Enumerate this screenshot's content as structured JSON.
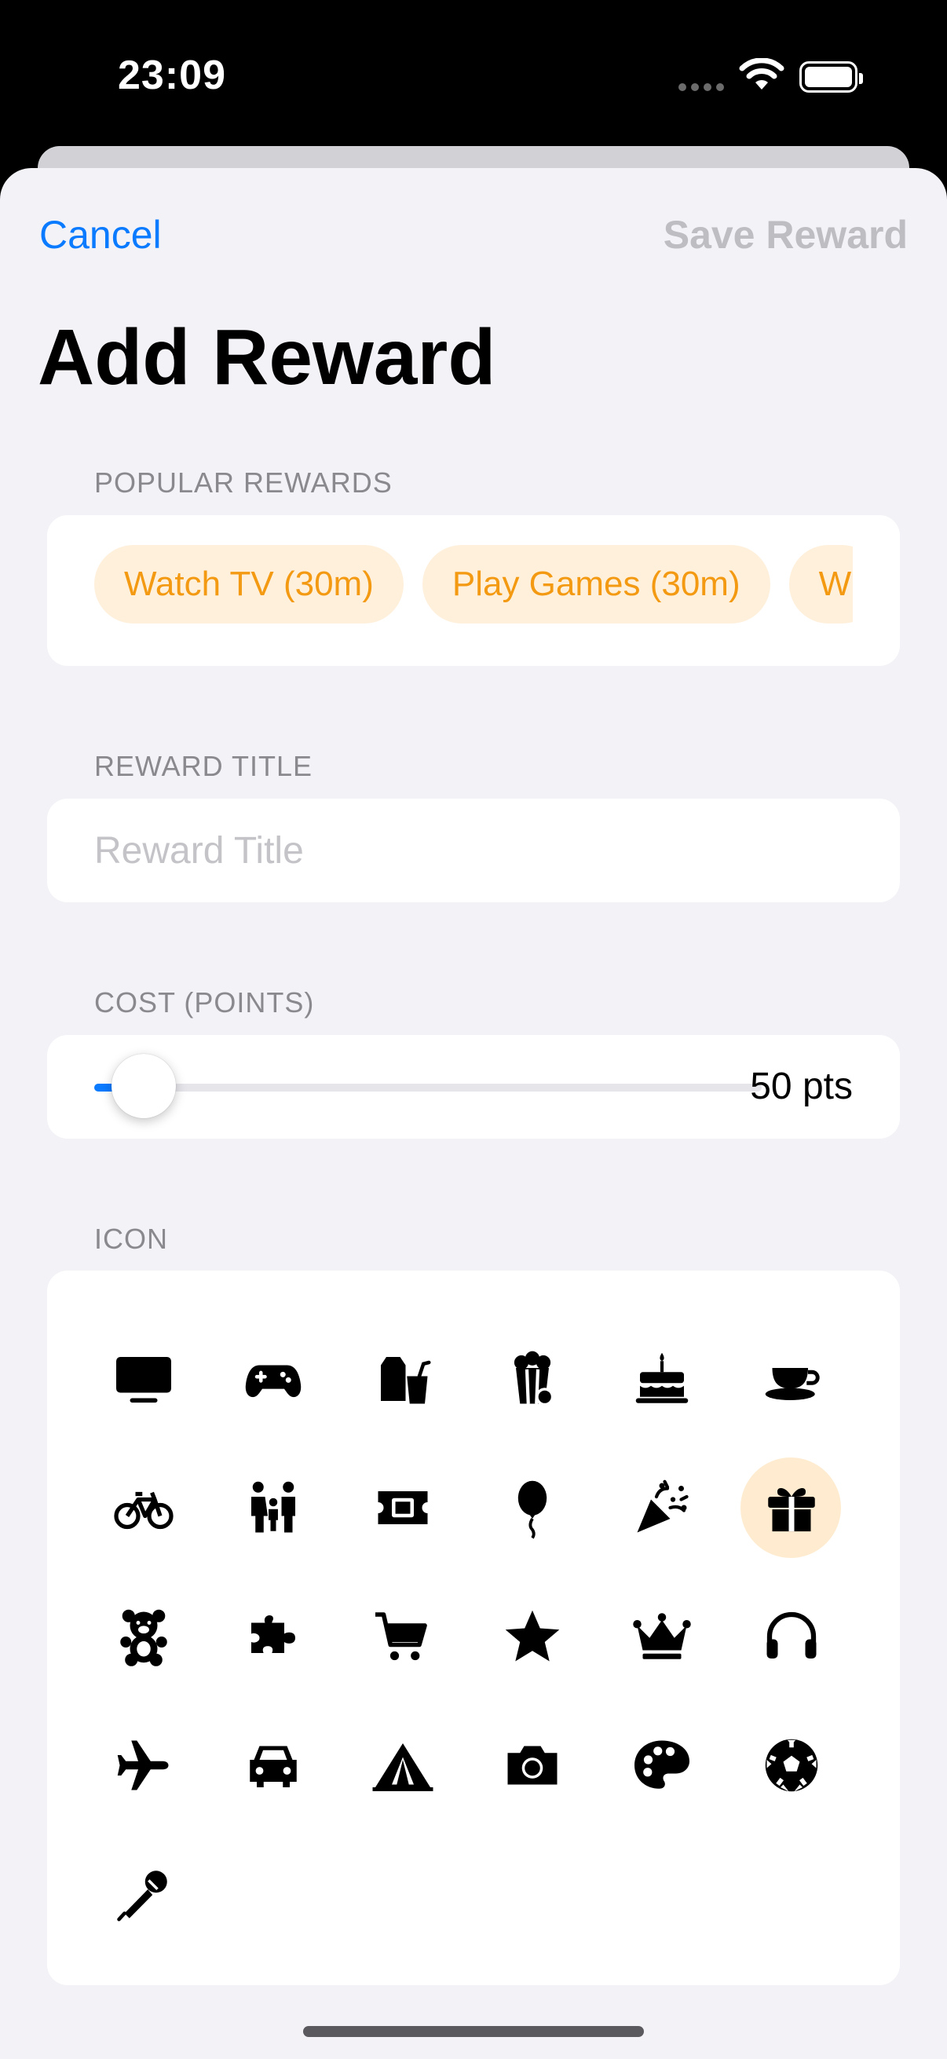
{
  "status_bar": {
    "time": "23:09"
  },
  "nav": {
    "cancel_label": "Cancel",
    "save_label": "Save Reward"
  },
  "title": "Add Reward",
  "popular_rewards": {
    "header": "POPULAR REWARDS",
    "chips": [
      "Watch TV (30m)",
      "Play Games (30m)",
      "W"
    ]
  },
  "reward_title": {
    "header": "REWARD TITLE",
    "placeholder": "Reward Title",
    "value": ""
  },
  "cost": {
    "header": "COST (POINTS)",
    "value_label": "50 pts",
    "slider_fraction": 0.05
  },
  "icon_section": {
    "header": "ICON",
    "selected_index": 11,
    "icons": [
      "tv-icon",
      "gamecontroller-icon",
      "takeout-bag-icon",
      "popcorn-icon",
      "birthday-cake-icon",
      "cup-and-saucer-icon",
      "bicycle-icon",
      "family-icon",
      "ticket-icon",
      "balloon-icon",
      "party-popper-icon",
      "gift-icon",
      "teddybear-icon",
      "puzzle-piece-icon",
      "cart-icon",
      "star-icon",
      "crown-icon",
      "headphones-icon",
      "airplane-icon",
      "car-icon",
      "tent-icon",
      "camera-icon",
      "paintpalette-icon",
      "soccerball-icon",
      "microphone-icon"
    ]
  },
  "colors": {
    "accent": "#0a7aff",
    "chip_bg": "#fff0dc",
    "chip_text": "#f39a12",
    "selected_icon_bg": "#ffecd0",
    "background": "#f2f2f7"
  }
}
